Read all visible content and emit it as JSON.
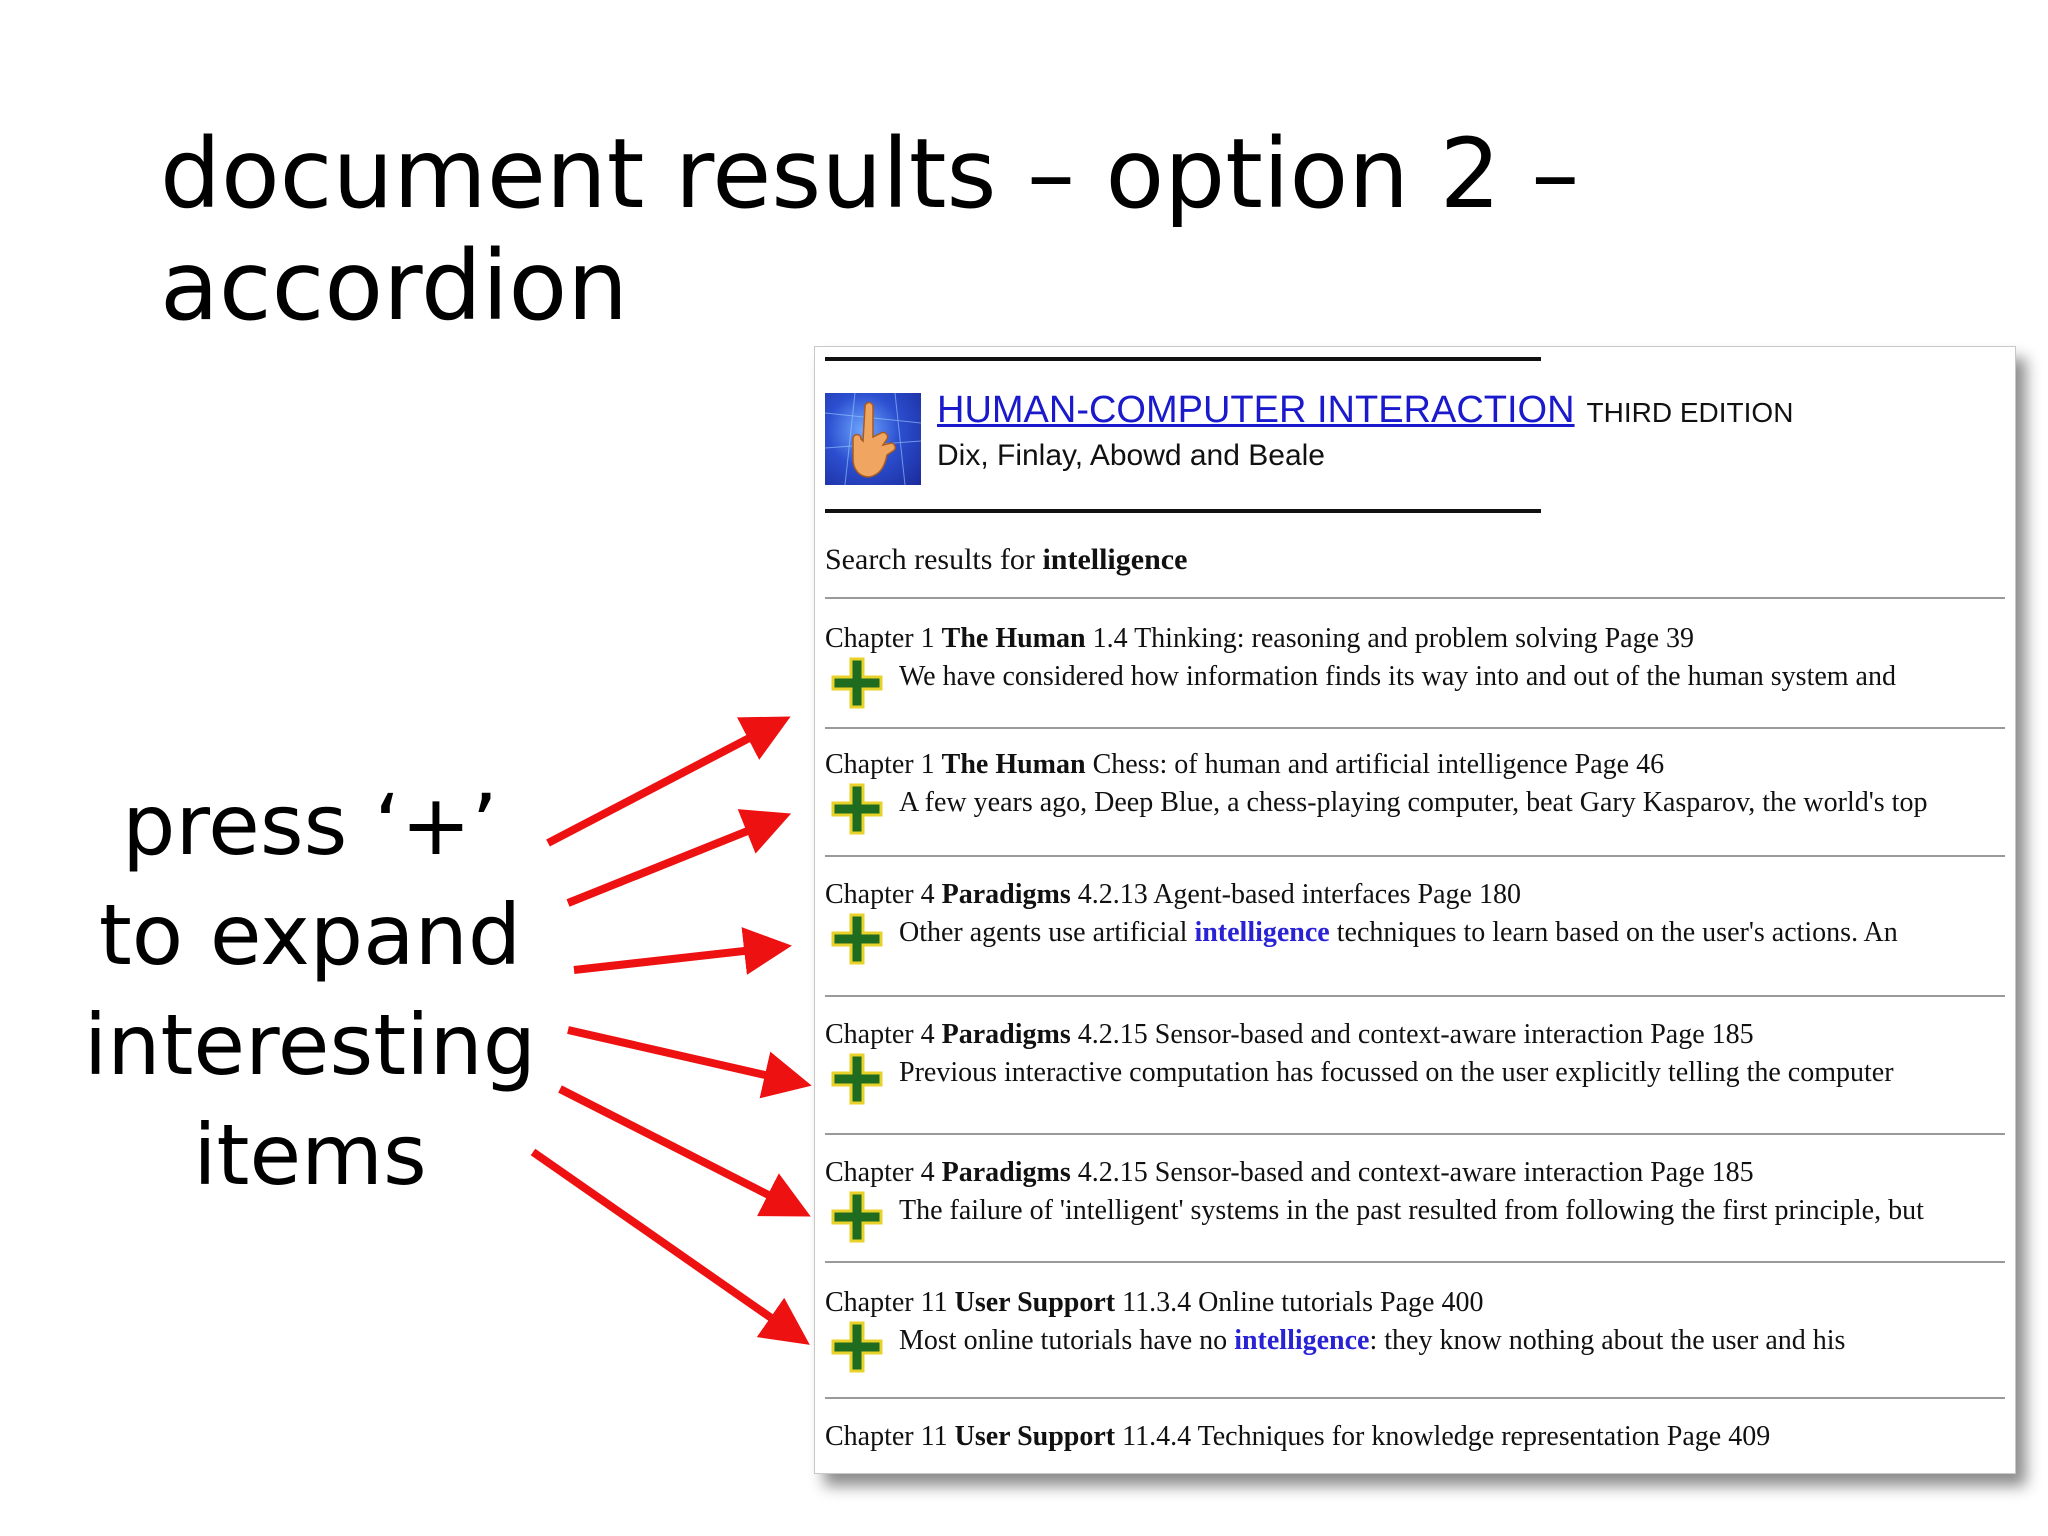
{
  "slide": {
    "title_line1": "document results – option 2 –",
    "title_line2": "accordion",
    "callout_lines": [
      "press ‘+’",
      "to expand",
      "interesting",
      "items"
    ]
  },
  "book": {
    "title": "HUMAN-COMPUTER INTERACTION",
    "edition": "THIRD EDITION",
    "authors": "Dix, Finlay, Abowd and Beale"
  },
  "search": {
    "prefix": "Search results for",
    "term": "intelligence"
  },
  "results": [
    {
      "chapter": "Chapter 1",
      "chapter_title": "The Human",
      "section": "1.4 Thinking: reasoning and problem solving Page 39",
      "snippet_before": "We have considered how information finds its way into and out of the human system and",
      "snippet_hl": "",
      "snippet_after": ""
    },
    {
      "chapter": "Chapter 1",
      "chapter_title": "The Human",
      "section": "Chess: of human and artificial intelligence Page 46",
      "snippet_before": "A few years ago, Deep Blue, a chess-playing computer, beat Gary Kasparov, the world's top",
      "snippet_hl": "",
      "snippet_after": ""
    },
    {
      "chapter": "Chapter 4",
      "chapter_title": "Paradigms",
      "section": "4.2.13 Agent-based interfaces Page 180",
      "snippet_before": "Other agents use artificial ",
      "snippet_hl": "intelligence",
      "snippet_after": " techniques to learn based on the user's actions. An"
    },
    {
      "chapter": "Chapter 4",
      "chapter_title": "Paradigms",
      "section": "4.2.15 Sensor-based and context-aware interaction Page 185",
      "snippet_before": "Previous interactive computation has focussed on the user explicitly telling the computer",
      "snippet_hl": "",
      "snippet_after": ""
    },
    {
      "chapter": "Chapter 4",
      "chapter_title": "Paradigms",
      "section": "4.2.15 Sensor-based and context-aware interaction Page 185",
      "snippet_before": "The failure of 'intelligent' systems in the past resulted from following the first principle, but",
      "snippet_hl": "",
      "snippet_after": ""
    },
    {
      "chapter": "Chapter 11",
      "chapter_title": "User Support",
      "section": "11.3.4 Online tutorials Page 400",
      "snippet_before": "Most online tutorials have no ",
      "snippet_hl": "intelligence",
      "snippet_after": ": they know nothing about the user and his"
    },
    {
      "chapter": "Chapter 11",
      "chapter_title": "User Support",
      "section": "11.4.4 Techniques for knowledge representation Page 409",
      "snippet_before": "",
      "snippet_hl": "",
      "snippet_after": ""
    }
  ],
  "colors": {
    "arrow": "#ee1111",
    "plus_fill": "#1f6b1f",
    "plus_outline": "#e8d22a",
    "link": "#1a1acc",
    "highlight": "#2a23d6"
  },
  "icons": {
    "expand": "plus-icon",
    "logo": "hand-touch-logo"
  }
}
